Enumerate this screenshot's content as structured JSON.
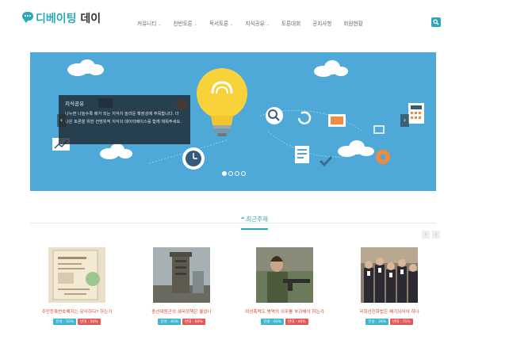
{
  "header": {
    "logo_part1": "디베이팅",
    "logo_part2": "데이",
    "nav": [
      {
        "label": "커뮤니티",
        "has_menu": true
      },
      {
        "label": "찬반토론",
        "has_menu": true
      },
      {
        "label": "독서토론",
        "has_menu": true
      },
      {
        "label": "지식공유",
        "has_menu": true
      },
      {
        "label": "토론대회",
        "has_menu": false
      },
      {
        "label": "공지사항",
        "has_menu": false
      },
      {
        "label": "회원현황",
        "has_menu": false
      }
    ],
    "search_icon": "search-icon",
    "accent_color": "#2ea7b9"
  },
  "banner": {
    "caption_title": "지식공유",
    "caption_text": "나누면 나눌수록 배가 되는 지식이 놀라운 확장성에 주목합니다. 더 나은 토론을 위한 전방위적 지식의 데이터베이스를 함께 채워주세요.",
    "slide_count": 4,
    "active_slide": 1,
    "background_color": "#4fa9d8"
  },
  "recent": {
    "title": "최근주제",
    "icon": "quote-icon",
    "items": [
      {
        "title": "주민등록번호폐지는 유익하다? 하는가",
        "pro": "찬성 : 50%",
        "con": "반대 : 50%"
      },
      {
        "title": "종선대원군의 쇄국정책은 옳았나",
        "pro": "찬성 : 40%",
        "con": "반대 : 60%"
      },
      {
        "title": "여성폭력도 병역의 의무를 부과해야 하는가",
        "pro": "찬성 : 60%",
        "con": "반대 : 40%"
      },
      {
        "title": "국회선진화법은 폐기되어야 하나",
        "pro": "찬성 : 29%",
        "con": "반대 : 71%"
      }
    ]
  }
}
